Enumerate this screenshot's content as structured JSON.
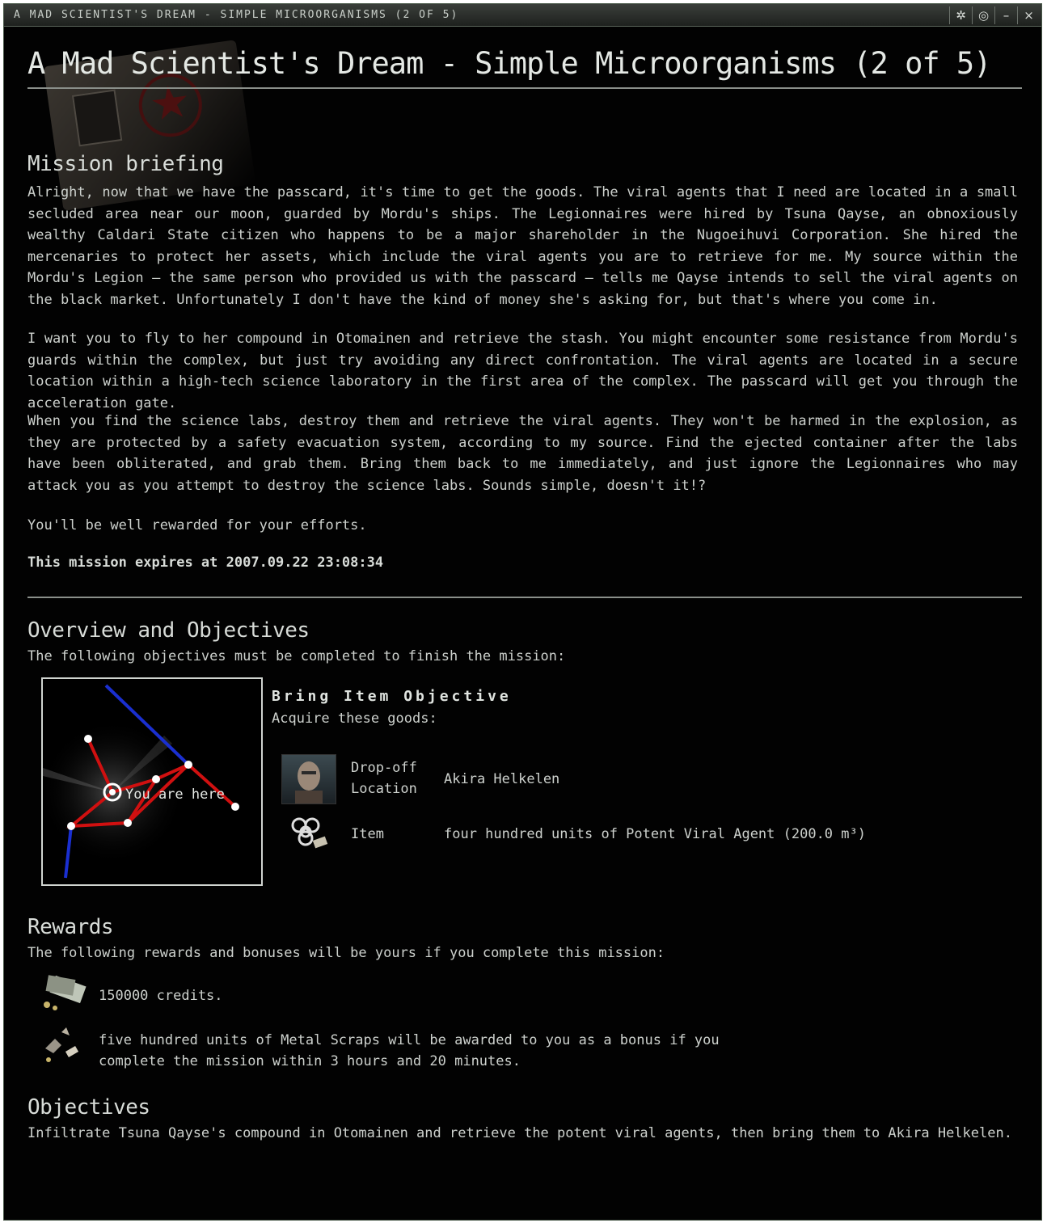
{
  "window": {
    "title": "A MAD SCIENTIST'S DREAM - SIMPLE MICROORGANISMS (2 OF 5)",
    "buttons": [
      "✲",
      "◎",
      "–",
      "×"
    ]
  },
  "page": {
    "heading": "A Mad Scientist's Dream - Simple Microorganisms (2 of 5)"
  },
  "briefing": {
    "heading": "Mission briefing",
    "paragraphs": [
      "Alright, now that we have the passcard, it's time to get the goods. The viral agents that I need are located in a small secluded area near our moon, guarded by Mordu's ships. The Legionnaires were hired by Tsuna Qayse, an obnoxiously wealthy Caldari State citizen who happens to be a major shareholder in the Nugoeihuvi Corporation. She hired the mercenaries to protect her assets, which include the viral agents you are to retrieve for me. My source within the Mordu's Legion — the same person who provided us with the passcard — tells me Qayse intends to sell the viral agents on the black market. Unfortunately I don't have the kind of money she's asking for, but that's where you come in.",
      "I want you to fly to her compound in Otomainen and retrieve the stash. You might encounter some resistance from Mordu's guards within the complex, but just try avoiding any direct confrontation. The viral agents are located in a secure location within a high-tech science laboratory in the first area of the complex. The passcard will get you through the acceleration gate.",
      "When you find the science labs, destroy them and retrieve the viral agents. They won't be harmed in the explosion, as they are protected by a safety evacuation system, according to my source. Find the ejected container after the labs have been obliterated, and grab them. Bring them back to me immediately, and just ignore the Legionnaires who may attack you as you attempt to destroy the science labs. Sounds simple, doesn't it!?",
      "You'll be well rewarded for your efforts."
    ],
    "expiry": "This mission expires at 2007.09.22 23:08:34"
  },
  "overview": {
    "heading": "Overview and Objectives",
    "intro": "The following objectives must be completed to finish the mission:",
    "map_label": "You are here",
    "objective_title": "Bring Item Objective",
    "objective_sub": "Acquire these goods:",
    "dropoff_label_1": "Drop-off",
    "dropoff_label_2": "Location",
    "dropoff_value": "Akira Helkelen",
    "item_label": "Item",
    "item_value": "four hundred units of Potent Viral Agent (200.0 m³)"
  },
  "rewards": {
    "heading": "Rewards",
    "intro": "The following rewards and bonuses will be yours if you complete this mission:",
    "credits": "150000 credits.",
    "bonus_line_1": "five hundred units of Metal Scraps will be awarded to you as a bonus if you",
    "bonus_line_2": "complete the mission within 3 hours and 20 minutes."
  },
  "objectives": {
    "heading": "Objectives",
    "text": "Infiltrate Tsuna Qayse's compound in Otomainen and retrieve the potent viral agents, then bring them to Akira Helkelen."
  },
  "colors": {
    "background": "#020202",
    "route_red": "#d01010",
    "route_blue": "#1a2fd0",
    "text": "#cdd1cd"
  }
}
